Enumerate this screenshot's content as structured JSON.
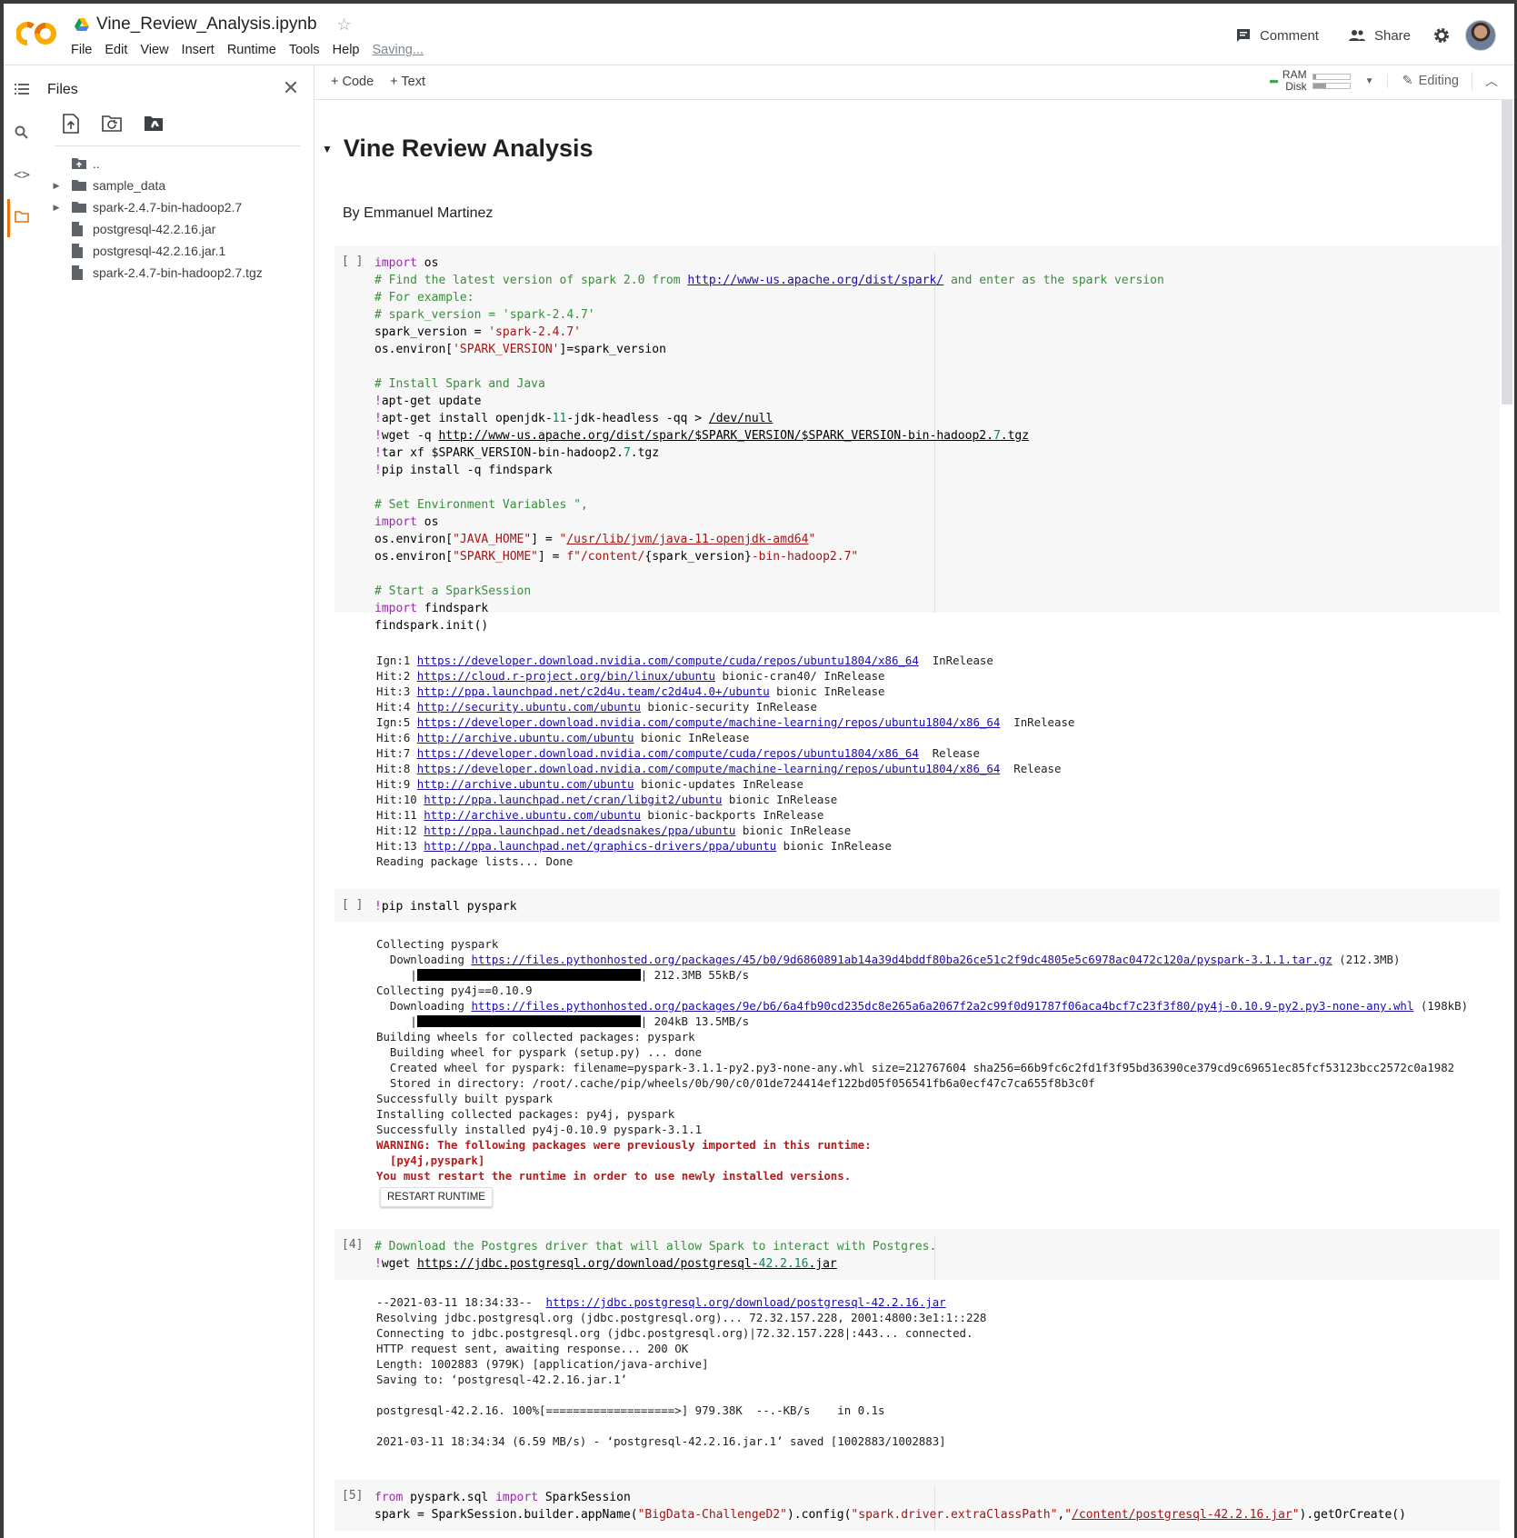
{
  "header": {
    "file_name": "Vine_Review_Analysis.ipynb",
    "menus": [
      "File",
      "Edit",
      "View",
      "Insert",
      "Runtime",
      "Tools",
      "Help"
    ],
    "saving": "Saving...",
    "comment_label": "Comment",
    "share_label": "Share"
  },
  "toolbar": {
    "add_code": "Code",
    "add_text": "Text",
    "ram_label": "RAM",
    "disk_label": "Disk",
    "ram_fraction": 0.08,
    "disk_fraction": 0.35,
    "editing_label": "Editing"
  },
  "files_panel": {
    "title": "Files",
    "parent": "..",
    "items": [
      {
        "name": "sample_data",
        "type": "folder"
      },
      {
        "name": "spark-2.4.7-bin-hadoop2.7",
        "type": "folder"
      },
      {
        "name": "postgresql-42.2.16.jar",
        "type": "file"
      },
      {
        "name": "postgresql-42.2.16.jar.1",
        "type": "file"
      },
      {
        "name": "spark-2.4.7-bin-hadoop2.7.tgz",
        "type": "file"
      }
    ]
  },
  "notebook": {
    "title": "Vine Review Analysis",
    "byline": "By Emmanuel Martinez",
    "cells": [
      {
        "prompt": "[ ]"
      },
      {
        "prompt": "[ ]"
      },
      {
        "prompt": "[4]"
      },
      {
        "prompt": "[5]"
      }
    ],
    "restart_button": "RESTART RUNTIME"
  },
  "colors": {
    "accent_orange": "#e8710a",
    "keyword": "#9c27b0",
    "comment": "#388e3c",
    "string": "#a31515",
    "link": "#1a0dab",
    "warning": "#b71c1c"
  }
}
